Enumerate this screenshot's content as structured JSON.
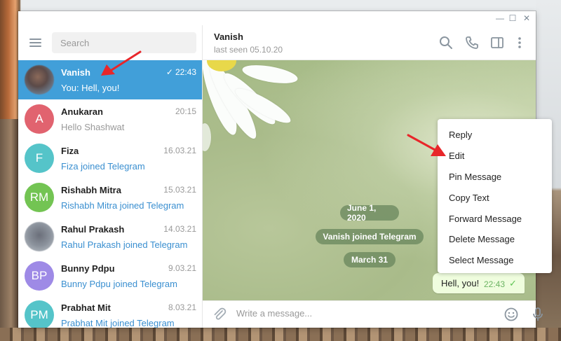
{
  "window": {
    "controls": {
      "minimize": "—",
      "maximize": "☐",
      "close": "✕"
    }
  },
  "sidebar": {
    "search_placeholder": "Search",
    "chats": [
      {
        "name": "Vanish",
        "time": "22:43",
        "preview": "You: Hell, you!",
        "avatar_type": "photo",
        "read_check": "✓",
        "active": true
      },
      {
        "name": "Anukaran",
        "time": "20:15",
        "preview": "Hello Shashwat",
        "avatar_initials": "A",
        "avatar_color": "#e1636f"
      },
      {
        "name": "Fiza",
        "time": "16.03.21",
        "preview": "Fiza joined Telegram",
        "avatar_initials": "F",
        "avatar_color": "#55c4c9"
      },
      {
        "name": "Rishabh Mitra",
        "time": "15.03.21",
        "preview": "Rishabh Mitra joined Telegram",
        "avatar_initials": "RM",
        "avatar_color": "#73c453"
      },
      {
        "name": "Rahul Prakash",
        "time": "14.03.21",
        "preview": "Rahul Prakash joined Telegram",
        "avatar_type": "photo"
      },
      {
        "name": "Bunny Pdpu",
        "time": "9.03.21",
        "preview": "Bunny Pdpu joined Telegram",
        "avatar_initials": "BP",
        "avatar_color": "#9e8ae6"
      },
      {
        "name": "Prabhat Mit",
        "time": "8.03.21",
        "preview": "Prabhat Mit joined Telegram",
        "avatar_initials": "PM",
        "avatar_color": "#55c4c9"
      }
    ]
  },
  "header": {
    "peer_name": "Vanish",
    "peer_status": "last seen 05.10.20"
  },
  "messages": {
    "service": [
      "June 1, 2020",
      "Vanish joined Telegram",
      "March 31"
    ],
    "bubble": {
      "text": "Hell, you!",
      "time": "22:43",
      "check": "✓"
    }
  },
  "composer": {
    "placeholder": "Write a message..."
  },
  "context_menu": {
    "items": [
      "Reply",
      "Edit",
      "Pin Message",
      "Copy Text",
      "Forward Message",
      "Delete Message",
      "Select Message"
    ]
  },
  "colors": {
    "accent": "#419fd9",
    "link": "#3a8fd0",
    "bubble_out": "#effdde",
    "annotation_arrow": "#e8262a"
  }
}
